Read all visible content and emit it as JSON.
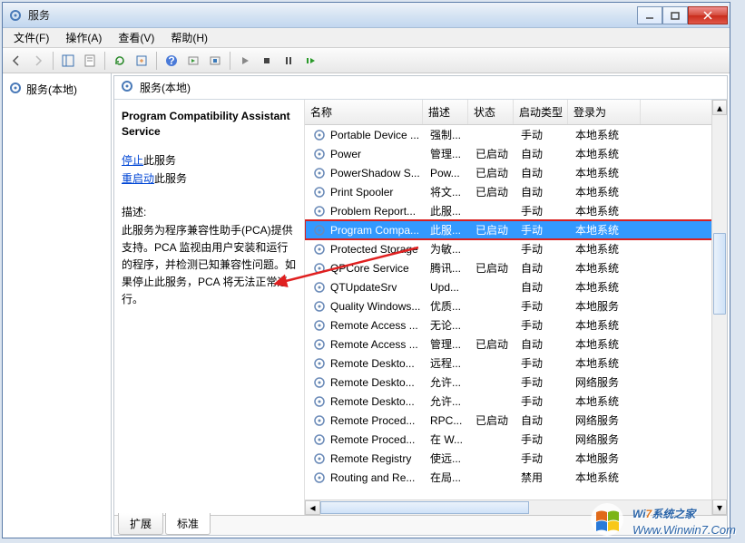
{
  "window": {
    "title": "服务"
  },
  "menu": {
    "file": "文件(F)",
    "action": "操作(A)",
    "view": "查看(V)",
    "help": "帮助(H)"
  },
  "left": {
    "root": "服务(本地)"
  },
  "rightHeader": {
    "title": "服务(本地)"
  },
  "detail": {
    "name": "Program Compatibility Assistant Service",
    "stop_prefix": "停止",
    "stop_suffix": "此服务",
    "restart_prefix": "重启动",
    "restart_suffix": "此服务",
    "desc_label": "描述:",
    "desc": "此服务为程序兼容性助手(PCA)提供支持。PCA 监视由用户安装和运行的程序，并检测已知兼容性问题。如果停止此服务，PCA 将无法正常运行。"
  },
  "columns": {
    "name": "名称",
    "desc": "描述",
    "status": "状态",
    "startup": "启动类型",
    "logon": "登录为"
  },
  "rows": [
    {
      "name": "Portable Device ...",
      "desc": "强制...",
      "status": "",
      "startup": "手动",
      "logon": "本地系统"
    },
    {
      "name": "Power",
      "desc": "管理...",
      "status": "已启动",
      "startup": "自动",
      "logon": "本地系统"
    },
    {
      "name": "PowerShadow S...",
      "desc": "Pow...",
      "status": "已启动",
      "startup": "自动",
      "logon": "本地系统"
    },
    {
      "name": "Print Spooler",
      "desc": "将文...",
      "status": "已启动",
      "startup": "自动",
      "logon": "本地系统"
    },
    {
      "name": "Problem Report...",
      "desc": "此服...",
      "status": "",
      "startup": "手动",
      "logon": "本地系统"
    },
    {
      "name": "Program Compa...",
      "desc": "此服...",
      "status": "已启动",
      "startup": "手动",
      "logon": "本地系统",
      "selected": true
    },
    {
      "name": "Protected Storage",
      "desc": "为敏...",
      "status": "",
      "startup": "手动",
      "logon": "本地系统"
    },
    {
      "name": "QPCore Service",
      "desc": "腾讯...",
      "status": "已启动",
      "startup": "自动",
      "logon": "本地系统"
    },
    {
      "name": "QTUpdateSrv",
      "desc": "Upd...",
      "status": "",
      "startup": "自动",
      "logon": "本地系统"
    },
    {
      "name": "Quality Windows...",
      "desc": "优质...",
      "status": "",
      "startup": "手动",
      "logon": "本地服务"
    },
    {
      "name": "Remote Access ...",
      "desc": "无论...",
      "status": "",
      "startup": "手动",
      "logon": "本地系统"
    },
    {
      "name": "Remote Access ...",
      "desc": "管理...",
      "status": "已启动",
      "startup": "自动",
      "logon": "本地系统"
    },
    {
      "name": "Remote Deskto...",
      "desc": "远程...",
      "status": "",
      "startup": "手动",
      "logon": "本地系统"
    },
    {
      "name": "Remote Deskto...",
      "desc": "允许...",
      "status": "",
      "startup": "手动",
      "logon": "网络服务"
    },
    {
      "name": "Remote Deskto...",
      "desc": "允许...",
      "status": "",
      "startup": "手动",
      "logon": "本地系统"
    },
    {
      "name": "Remote Proced...",
      "desc": "RPC...",
      "status": "已启动",
      "startup": "自动",
      "logon": "网络服务"
    },
    {
      "name": "Remote Proced...",
      "desc": "在 W...",
      "status": "",
      "startup": "手动",
      "logon": "网络服务"
    },
    {
      "name": "Remote Registry",
      "desc": "使远...",
      "status": "",
      "startup": "手动",
      "logon": "本地服务"
    },
    {
      "name": "Routing and Re...",
      "desc": "在局...",
      "status": "",
      "startup": "禁用",
      "logon": "本地系统"
    }
  ],
  "tabs": {
    "extended": "扩展",
    "standard": "标准"
  },
  "watermark": {
    "brand_pre": "Wi",
    "brand_num": "7",
    "brand_post": "系统之家",
    "url": "Www.Winwin7.Com"
  }
}
